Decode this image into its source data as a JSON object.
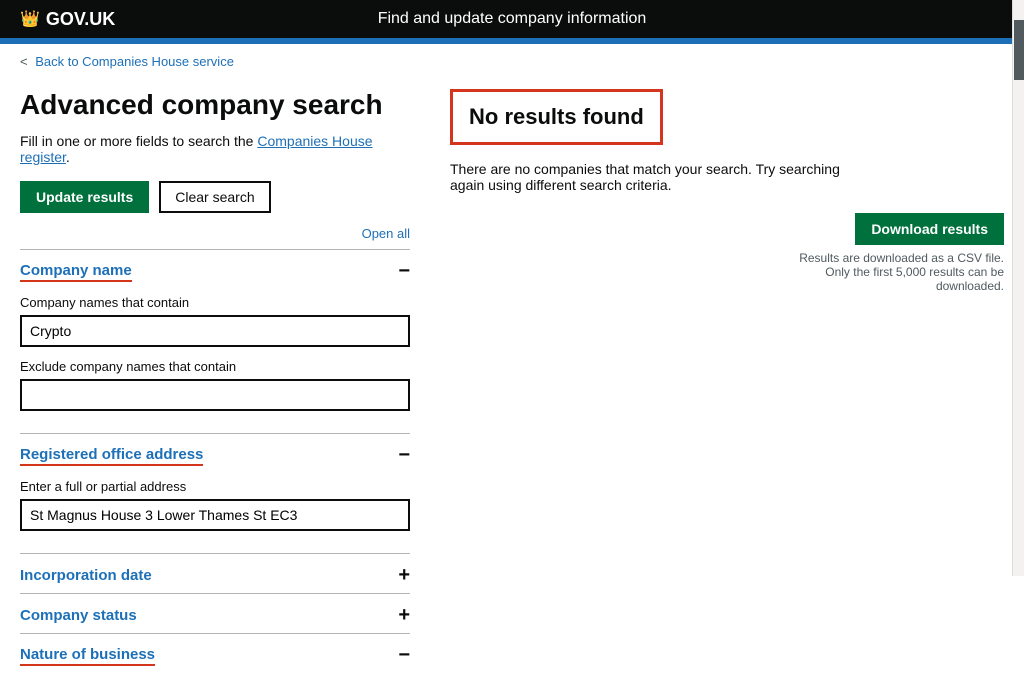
{
  "header": {
    "logo_text": "GOV.UK",
    "crown_symbol": "♛",
    "title": "Find and update company information"
  },
  "breadcrumb": {
    "link_text": "Back to Companies House service",
    "chevron": "<"
  },
  "page": {
    "title": "Advanced company search",
    "subtitle_text": "Fill in one or more fields to search the Companies House register.",
    "subtitle_link": "Companies House register"
  },
  "buttons": {
    "update_results": "Update results",
    "clear_search": "Clear search",
    "open_all": "Open all",
    "download_results": "Download results"
  },
  "company_name_section": {
    "label": "Company name",
    "toggle": "−",
    "contains_label": "Company names that contain",
    "contains_value": "Crypto",
    "exclude_label": "Exclude company names that contain",
    "exclude_value": "",
    "exclude_placeholder": ""
  },
  "registered_office_section": {
    "label": "Registered office address",
    "toggle": "−",
    "address_label": "Enter a full or partial address",
    "address_value": "St Magnus House 3 Lower Thames St EC3"
  },
  "incorporation_date_section": {
    "label": "Incorporation date",
    "toggle": "+"
  },
  "company_status_section": {
    "label": "Company status",
    "toggle": "+"
  },
  "nature_of_business_section": {
    "label": "Nature of business",
    "toggle": "−"
  },
  "results": {
    "no_results_title": "No results found",
    "no_results_text": "There are no companies that match your search. Try searching again using different search criteria.",
    "download_note": "Results are downloaded as a CSV file. Only the first 5,000 results can be downloaded."
  }
}
